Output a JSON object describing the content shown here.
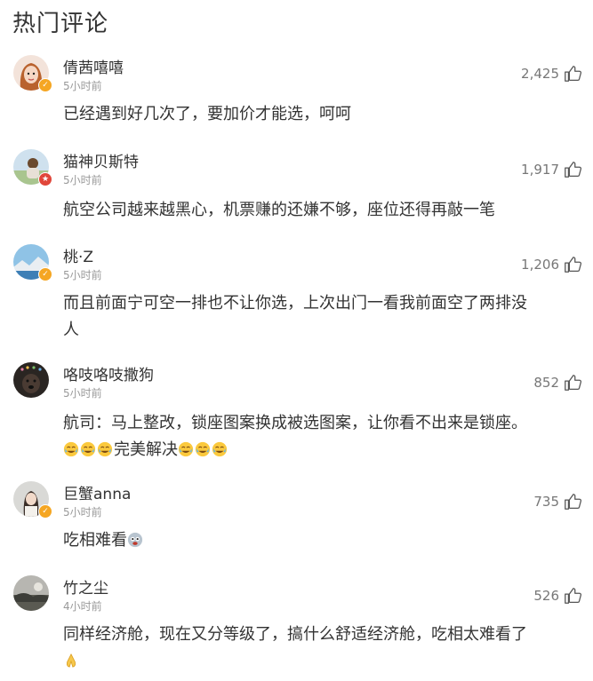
{
  "section_title": "热门评论",
  "comments": [
    {
      "username": "倩茜嘻嘻",
      "time": "5小时前",
      "likes": "2,425",
      "text": "已经遇到好几次了，要加价才能选，呵呵",
      "text2": "",
      "badge_color": "#f5a623"
    },
    {
      "username": "猫神贝斯特",
      "time": "5小时前",
      "likes": "1,917",
      "text": "航空公司越来越黑心，机票赚的还嫌不够，座位还得再敲一笔",
      "text2": "",
      "badge_color": "#e0463a"
    },
    {
      "username": "桃·Z",
      "time": "5小时前",
      "likes": "1,206",
      "text": "而且前面宁可空一排也不让你选，上次出门一看我前面空了两排没",
      "text2": "人",
      "badge_color": "#f5a623"
    },
    {
      "username": "咯吱咯吱撒狗",
      "time": "5小时前",
      "likes": "852",
      "text": "航司：马上整改，锁座图案换成被选图案，让你看不出来是锁座。",
      "text2": "完美解决",
      "badge_color": ""
    },
    {
      "username": "巨蟹anna",
      "time": "5小时前",
      "likes": "735",
      "text": "吃相难看",
      "text2": "",
      "badge_color": "#f5a623"
    },
    {
      "username": "竹之尘",
      "time": "4小时前",
      "likes": "526",
      "text": "同样经济舱，现在又分等级了，搞什么舒适经济舱，吃相太难看了",
      "text2": "",
      "badge_color": ""
    }
  ],
  "icons": {
    "like": "thumb-up-icon",
    "verified": "verified-badge-icon",
    "emoji_cry": "crying-laugh-emoji-icon",
    "emoji_angry": "angry-emoji-icon",
    "emoji_pray": "pray-emoji-icon"
  }
}
